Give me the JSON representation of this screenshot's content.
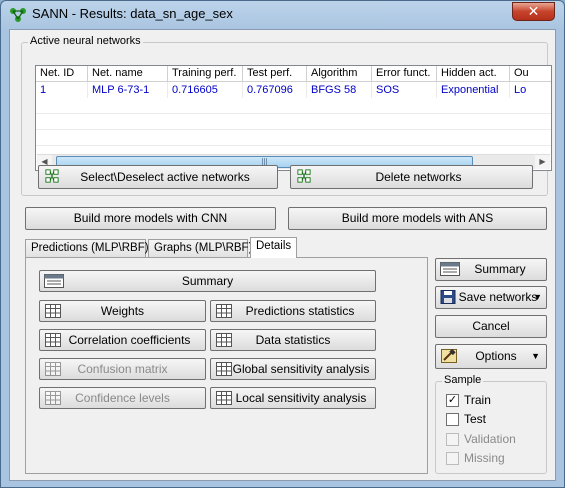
{
  "window": {
    "title": "SANN - Results: data_sn_age_sex",
    "close": "✕"
  },
  "active_networks": {
    "title": "Active neural networks",
    "columns": [
      "Net. ID",
      "Net. name",
      "Training perf.",
      "Test perf.",
      "Algorithm",
      "Error funct.",
      "Hidden act.",
      "Ou"
    ],
    "rows": [
      [
        "1",
        "MLP 6-73-1",
        "0.716605",
        "0.767096",
        "BFGS 58",
        "SOS",
        "Exponential",
        "Lo"
      ]
    ],
    "select_button": "Select\\Deselect active networks",
    "delete_button": "Delete networks"
  },
  "build_cnn_button": "Build more models with CNN",
  "build_ans_button": "Build more models with ANS",
  "tabs": [
    "Predictions (MLP\\RBF)",
    "Graphs (MLP\\RBF)",
    "Details"
  ],
  "details": {
    "summary": "Summary",
    "weights": "Weights",
    "predictions_statistics": "Predictions statistics",
    "correlation_coefficients": "Correlation coefficients",
    "data_statistics": "Data statistics",
    "confusion_matrix": "Confusion matrix",
    "global_sensitivity": "Global sensitivity analysis",
    "confidence_levels": "Confidence levels",
    "local_sensitivity": "Local sensitivity analysis"
  },
  "right_panel": {
    "summary": "Summary",
    "save_networks": "Save networks",
    "cancel": "Cancel",
    "options": "Options"
  },
  "sample": {
    "title": "Sample",
    "items": [
      {
        "label": "Train",
        "checked": true,
        "enabled": true
      },
      {
        "label": "Test",
        "checked": false,
        "enabled": true
      },
      {
        "label": "Validation",
        "checked": false,
        "enabled": false
      },
      {
        "label": "Missing",
        "checked": false,
        "enabled": false
      }
    ]
  }
}
